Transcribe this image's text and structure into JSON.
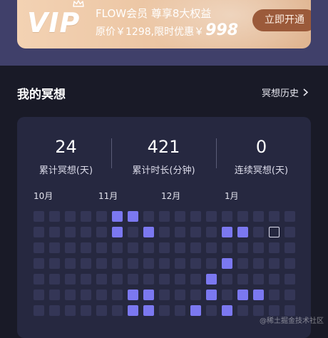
{
  "vip": {
    "logo": "VIP",
    "title": "FLOW会员  尊享8大权益",
    "original_price": "原价￥1298,限时优惠￥",
    "sale_price": "998",
    "open_button": "立即开通"
  },
  "section": {
    "title": "我的冥想",
    "history_link": "冥想历史"
  },
  "stats": [
    {
      "value": "24",
      "label": "累计冥想(天)"
    },
    {
      "value": "421",
      "label": "累计时长(分钟)"
    },
    {
      "value": "0",
      "label": "连续冥想(天)"
    }
  ],
  "heatmap": {
    "months": [
      "10月",
      "11月",
      "12月",
      "1月"
    ],
    "columns": 17,
    "rows": 7,
    "highlight_color": "#7b78f0",
    "empty_color": "#343656",
    "active": [
      [
        0,
        5
      ],
      [
        0,
        6
      ],
      [
        1,
        5
      ],
      [
        1,
        7
      ],
      [
        1,
        12
      ],
      [
        1,
        13
      ],
      [
        3,
        12
      ],
      [
        4,
        11
      ],
      [
        5,
        6
      ],
      [
        5,
        7
      ],
      [
        5,
        11
      ],
      [
        5,
        13
      ],
      [
        5,
        14
      ],
      [
        6,
        6
      ],
      [
        6,
        7
      ],
      [
        6,
        10
      ],
      [
        6,
        12
      ]
    ],
    "today": [
      1,
      15
    ]
  },
  "watermark": "@稀土掘金技术社区"
}
